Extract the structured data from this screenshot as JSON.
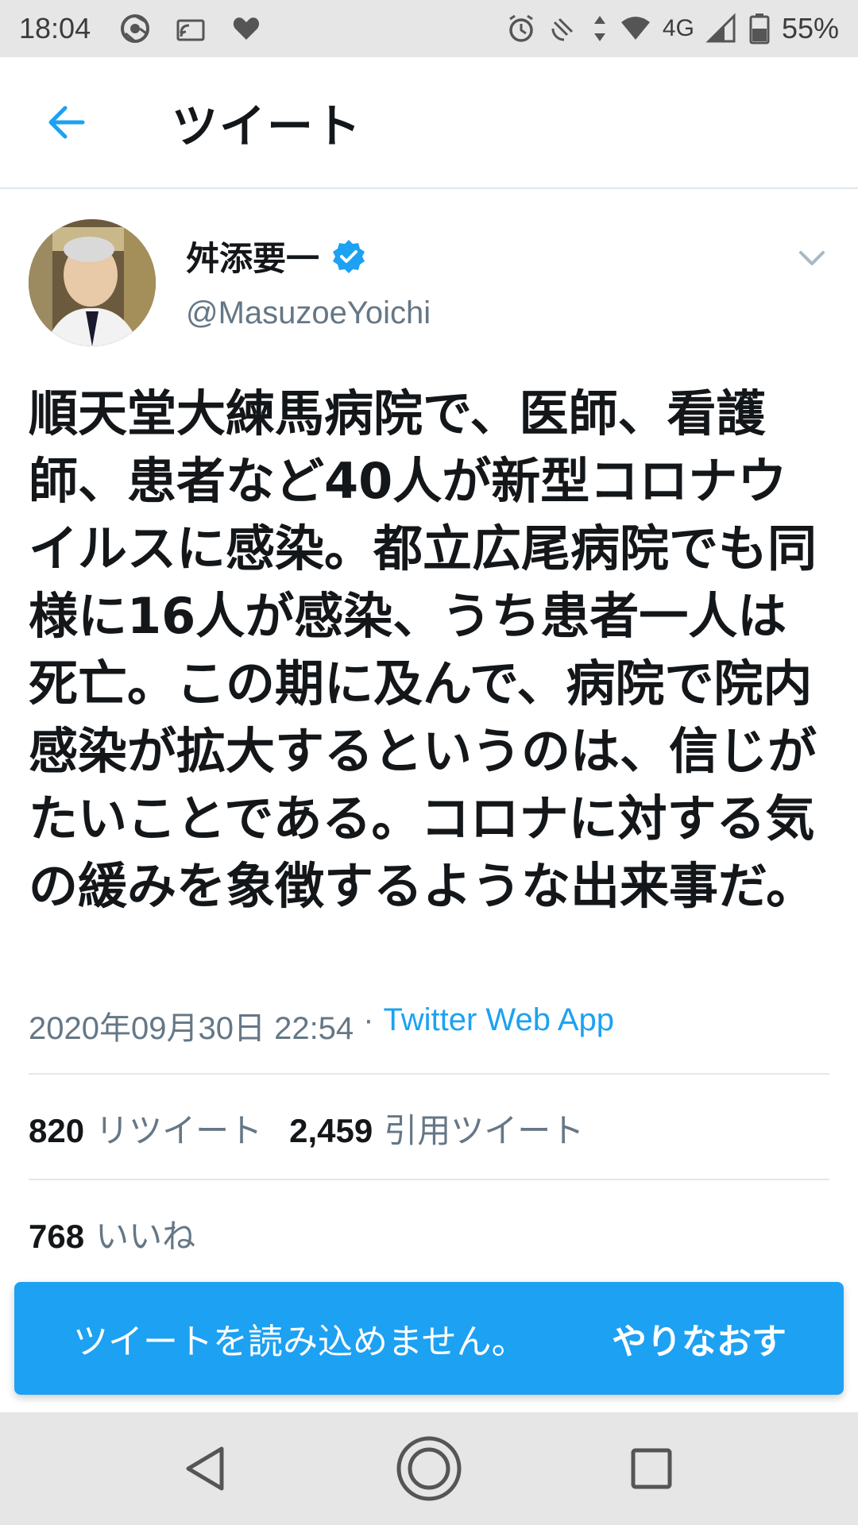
{
  "status_bar": {
    "time": "18:04",
    "network": "4G",
    "battery": "55%",
    "icons_left": [
      "chrome-icon",
      "cast-icon",
      "heart-icon"
    ],
    "icons_right": [
      "alarm-icon",
      "nfc-icon",
      "data-arrows-icon",
      "wifi-icon",
      "signal-icon",
      "battery-icon"
    ]
  },
  "app_bar": {
    "title": "ツイート",
    "back_icon": "arrow-left-icon"
  },
  "tweet": {
    "author_name": "舛添要一",
    "author_handle": "@MasuzoeYoichi",
    "verified": true,
    "text": "順天堂大練馬病院で、医師、看護師、患者など40人が新型コロナウイルスに感染。都立広尾病院でも同様に16人が感染、うち患者一人は死亡。この期に及んで、病院で院内感染が拡大するというのは、信じがたいことである。コロナに対する気の緩みを象徴するような出来事だ。",
    "timestamp": "2020年09月30日 22:54",
    "separator": "·",
    "source": "Twitter Web App",
    "retweets_count": "820",
    "retweets_label": "リツイート",
    "quotes_count": "2,459",
    "quotes_label": "引用ツイート",
    "likes_count": "768",
    "likes_label": "いいね"
  },
  "snackbar": {
    "message": "ツイートを読み込めません。",
    "action": "やりなおす"
  },
  "colors": {
    "accent": "#1da1f2",
    "text_primary": "#14171a",
    "text_secondary": "#657786",
    "status_bar_bg": "#e6e6e6"
  }
}
